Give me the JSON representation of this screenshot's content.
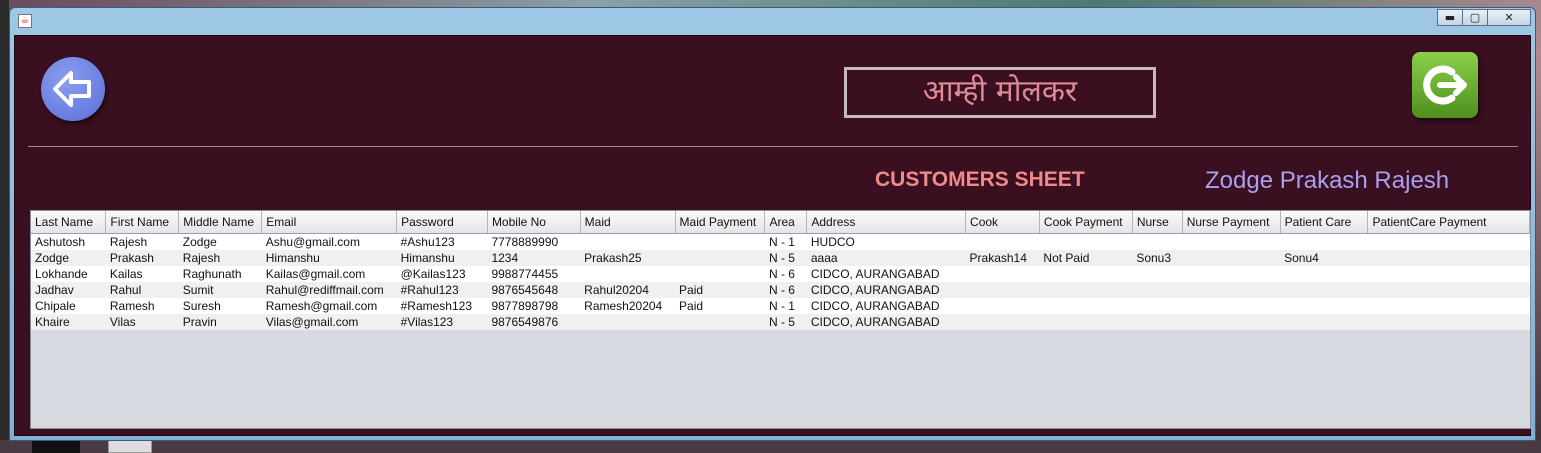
{
  "window": {
    "app_icon": "java-cup-icon",
    "controls": {
      "minimize": "▬",
      "maximize": "▢",
      "close": "✕"
    }
  },
  "header": {
    "back_icon": "back-arrow-icon",
    "title": "आम्ही मोलकर",
    "logout_icon": "logout-icon"
  },
  "sheet": {
    "title": "CUSTOMERS SHEET",
    "user": "Zodge Prakash Rajesh"
  },
  "colors": {
    "background": "#3a0f1f",
    "title_text": "#e08a96",
    "sheet_title": "#f08a8a",
    "user_name": "#a8a0f0",
    "back_button": "#6a7ee0",
    "logout_button": "#6ab032"
  },
  "table": {
    "columns": [
      "Last Name",
      "First Name",
      "Middle Name",
      "Email",
      "Password",
      "Mobile No",
      "Maid",
      "Maid Payment",
      "Area",
      "Address",
      "Cook",
      "Cook Payment",
      "Nurse",
      "Nurse Payment",
      "Patient Care",
      "PatientCare Payment"
    ],
    "rows": [
      [
        "Ashutosh",
        "Rajesh",
        "Zodge",
        "Ashu@gmail.com",
        "#Ashu123",
        "7778889990",
        "",
        "",
        "N - 1",
        "HUDCO",
        "",
        "",
        "",
        "",
        "",
        ""
      ],
      [
        "Zodge",
        "Prakash",
        "Rajesh",
        "Himanshu",
        "Himanshu",
        "1234",
        "Prakash25",
        "",
        "N - 5",
        "aaaa",
        "Prakash14",
        "Not Paid",
        "Sonu3",
        "",
        "Sonu4",
        ""
      ],
      [
        "Lokhande",
        "Kailas",
        "Raghunath",
        "Kailas@gmail.com",
        "@Kailas123",
        "9988774455",
        "",
        "",
        "N - 6",
        "CIDCO, AURANGABAD",
        "",
        "",
        "",
        "",
        "",
        ""
      ],
      [
        "Jadhav",
        "Rahul",
        "Sumit",
        "Rahul@rediffmail.com",
        "#Rahul123",
        "9876545648",
        "Rahul20204",
        "Paid",
        "N - 6",
        "CIDCO, AURANGABAD",
        "",
        "",
        "",
        "",
        "",
        ""
      ],
      [
        "Chipale",
        "Ramesh",
        "Suresh",
        "Ramesh@gmail.com",
        "#Ramesh123",
        "9877898798",
        "Ramesh20204",
        "Paid",
        "N - 1",
        "CIDCO, AURANGABAD",
        "",
        "",
        "",
        "",
        "",
        ""
      ],
      [
        "Khaire",
        "Vilas",
        "Pravin",
        "Vilas@gmail.com",
        "#Vilas123",
        "9876549876",
        "",
        "",
        "N - 5",
        "CIDCO, AURANGABAD",
        "",
        "",
        "",
        "",
        "",
        ""
      ]
    ]
  }
}
